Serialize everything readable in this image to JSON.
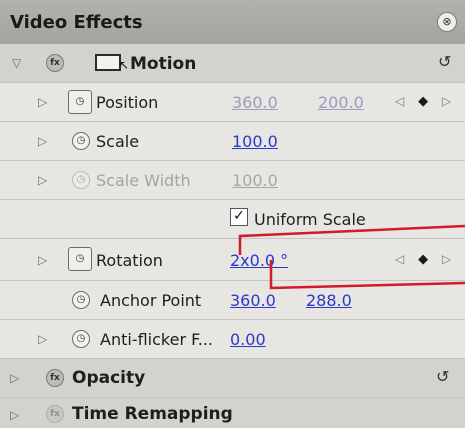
{
  "panel": {
    "title": "Video Effects",
    "header_button_glyph": "⊗"
  },
  "motion": {
    "label": "Motion",
    "expand_glyph": "▽",
    "fx_glyph": "fx",
    "icon_cursor_glyph": "↖",
    "reset_glyph": "↺"
  },
  "properties": {
    "position": {
      "label": "Position",
      "values": [
        "360.0",
        "200.0"
      ]
    },
    "scale": {
      "label": "Scale",
      "value": "100.0"
    },
    "scale_width": {
      "label": "Scale Width",
      "value": "100.0"
    },
    "uniform_scale": {
      "label": "Uniform Scale",
      "checked": true,
      "check_glyph": "✓"
    },
    "rotation": {
      "label": "Rotation",
      "value": "2x0.0 °"
    },
    "anchor_point": {
      "label": "Anchor Point",
      "values": [
        "360.0",
        "288.0"
      ]
    },
    "anti_flicker": {
      "label": "Anti-flicker F...",
      "value": "0.00"
    }
  },
  "opacity": {
    "label": "Opacity",
    "reset_glyph": "↺"
  },
  "time_remapping": {
    "label": "Time Remapping"
  },
  "glyphs": {
    "triangle_right": "▷",
    "keyframe_prev": "◁",
    "keyframe_next": "▷",
    "keyframe_diamond": "◆",
    "stopwatch": "◷"
  },
  "colors": {
    "value_link": "#2b39c9",
    "callout_line": "#d11a2a",
    "header_bg": "#a8a7a2"
  }
}
